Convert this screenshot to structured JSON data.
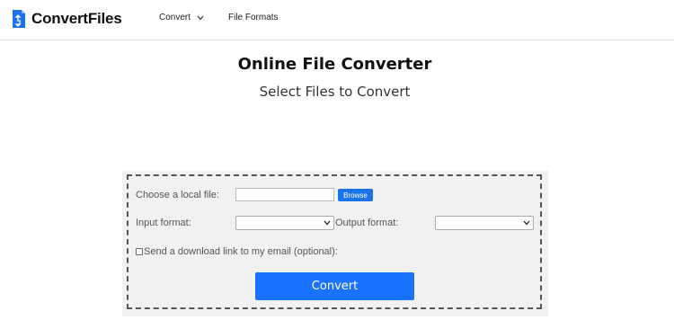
{
  "brand": {
    "name": "ConvertFiles"
  },
  "nav": {
    "convert": "Convert",
    "file_formats": "File Formats"
  },
  "main": {
    "title": "Online File Converter",
    "subtitle": "Select Files to Convert"
  },
  "form": {
    "local_file_label": "Choose a local file:",
    "file_value": "",
    "browse_label": "Browse",
    "input_format_label": "Input format:",
    "input_format_value": "",
    "output_format_label": "Output format:",
    "output_format_value": "",
    "email_checkbox_label": "Send a download link to my email (optional):",
    "email_checked": false,
    "convert_label": "Convert"
  },
  "colors": {
    "accent": "#1a73ff",
    "panel_bg": "#f1f1f1"
  }
}
